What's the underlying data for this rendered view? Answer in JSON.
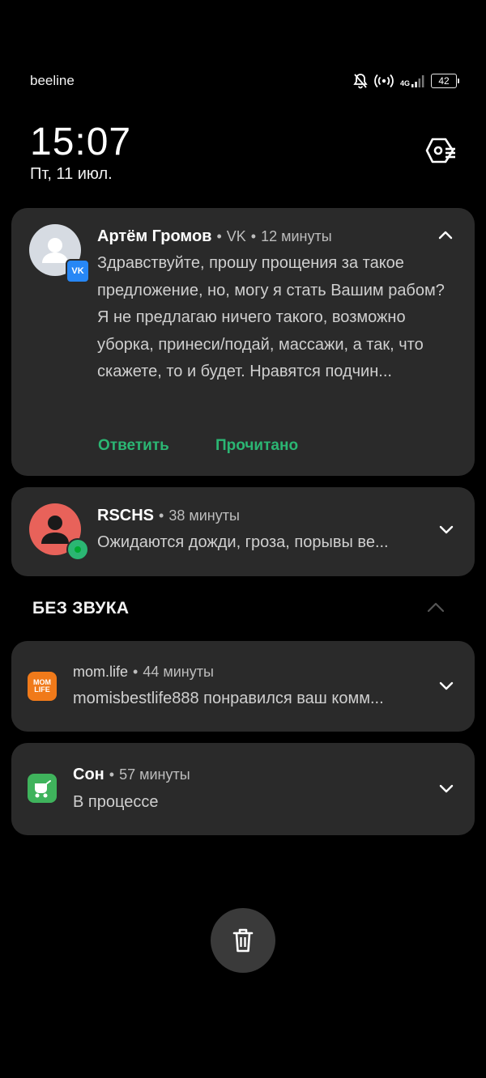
{
  "status_bar": {
    "carrier": "beeline",
    "network": "4G",
    "battery": "42",
    "icons": [
      "bell-off-icon",
      "hotspot-icon",
      "signal-icon",
      "battery-icon"
    ]
  },
  "lockscreen": {
    "time": "15:07",
    "date": "Пт, 11 июл."
  },
  "notifications": [
    {
      "sender": "Артём Громов",
      "app": "VK",
      "time": "12 минуты",
      "text": "Здравствуйте, прошу прощения за такое предложение, но, могу я стать Вашим рабом? Я не предлагаю ничего такого, возможно уборка, принеси/подай, массажи, а так, что скажете, то и будет. Нравятся подчин...",
      "actions": [
        "Ответить",
        "Прочитано"
      ],
      "expanded": true
    },
    {
      "sender": "RSCHS",
      "time": "38 минуты",
      "text": "Ожидаются дожди, гроза, порывы ве..."
    }
  ],
  "silent_section": {
    "title": "БЕЗ ЗВУКА",
    "items": [
      {
        "app": "mom.life",
        "icon_text": "MOM LIFE",
        "time": "44 минуты",
        "text": "momisbestlife888 понравился ваш комм..."
      },
      {
        "app": "Сон",
        "time": "57 минуты",
        "text": "В процессе"
      }
    ]
  },
  "colors": {
    "background": "#000000",
    "card": "#2a2a2a",
    "action_green": "#2bb673",
    "vk_blue": "#2787f5",
    "rschs_red": "#e8625a",
    "momlife_orange": "#f07a1a",
    "sleep_green": "#3fb35c"
  }
}
